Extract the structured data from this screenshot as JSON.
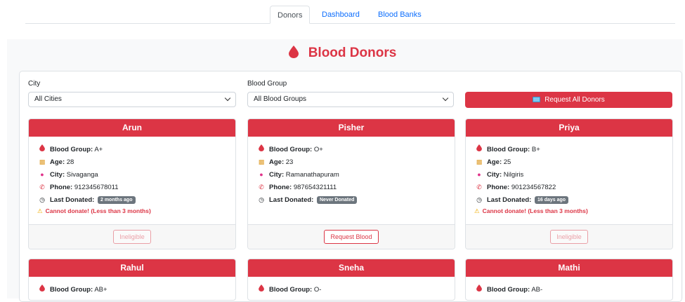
{
  "nav": {
    "tabs": [
      {
        "label": "Donors",
        "active": true
      },
      {
        "label": "Dashboard",
        "active": false
      },
      {
        "label": "Blood Banks",
        "active": false
      }
    ]
  },
  "page": {
    "title": "Blood Donors"
  },
  "filters": {
    "city_label": "City",
    "city_value": "All Cities",
    "group_label": "Blood Group",
    "group_value": "All Blood Groups",
    "request_all_label": "Request All Donors"
  },
  "labels": {
    "blood_group": "Blood Group:",
    "age": "Age:",
    "city": "City:",
    "phone": "Phone:",
    "last_donated": "Last Donated:"
  },
  "donors": [
    {
      "name": "Arun",
      "blood_group": "A+",
      "age": "28",
      "city": "Sivaganga",
      "phone": "912345678011",
      "last_donated": "2 months ago",
      "warning": "Cannot donate! (Less than 3 months)",
      "action": "Ineligible"
    },
    {
      "name": "Pisher",
      "blood_group": "O+",
      "age": "23",
      "city": "Ramanathapuram",
      "phone": "987654321111",
      "last_donated": "Never Donated",
      "warning": "",
      "action": "Request Blood"
    },
    {
      "name": "Priya",
      "blood_group": "B+",
      "age": "25",
      "city": "Nilgiris",
      "phone": "901234567822",
      "last_donated": "16 days ago",
      "warning": "Cannot donate! (Less than 3 months)",
      "action": "Ineligible"
    },
    {
      "name": "Rahul",
      "blood_group": "AB+"
    },
    {
      "name": "Sneha",
      "blood_group": "O-"
    },
    {
      "name": "Mathi",
      "blood_group": "AB-"
    }
  ],
  "colors": {
    "primary": "#dc3545",
    "link": "#0d6efd",
    "badge": "#6c757d"
  }
}
